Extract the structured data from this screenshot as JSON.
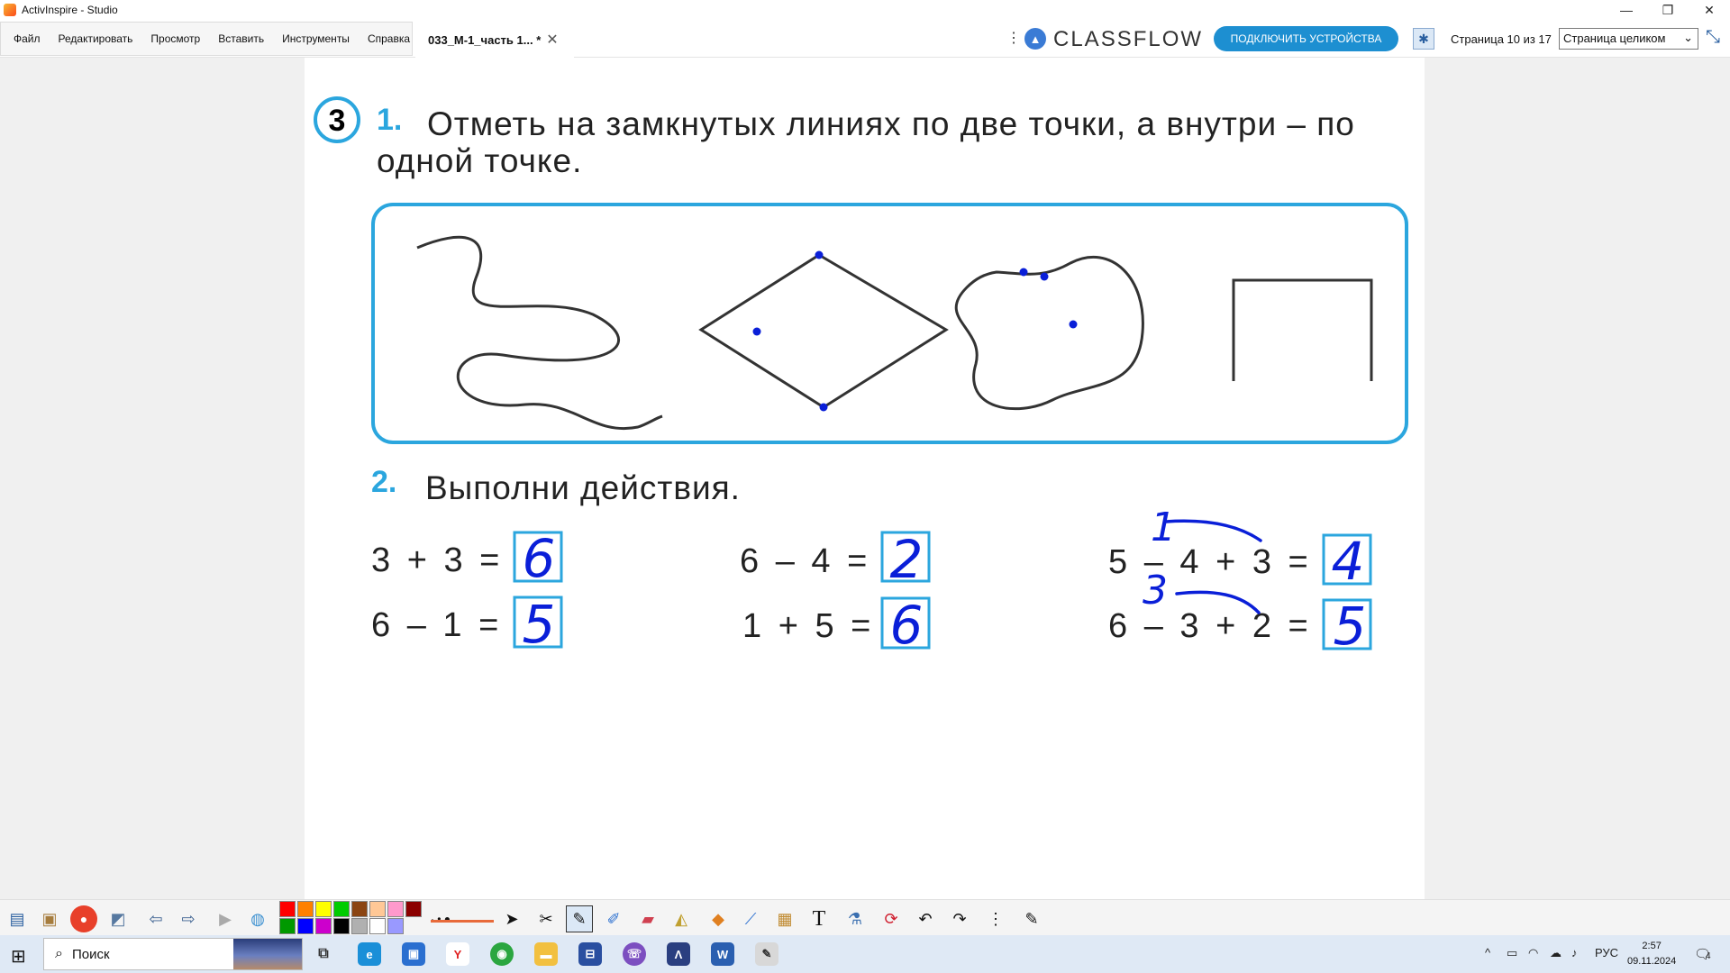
{
  "window": {
    "title": "ActivInspire - Studio",
    "minimize": "—",
    "restore": "❐",
    "close": "✕"
  },
  "menu": [
    "Файл",
    "Редактировать",
    "Просмотр",
    "Вставить",
    "Инструменты",
    "Справка"
  ],
  "tab": {
    "label": "033_М-1_часть 1... *",
    "close": "✕"
  },
  "classflow": {
    "logo": "CLASSFLOW",
    "connect_label": "ПОДКЛЮЧИТЬ УСТРОЙСТВА"
  },
  "page": {
    "counter": "Страница 10 из 17",
    "zoom": "Страница целиком"
  },
  "worksheet": {
    "lesson_number": "3",
    "task1_number": "1.",
    "task1_line1": "Отметь на замкнутых линиях по две точки, а внутри – по",
    "task1_line2": "одной точке.",
    "task2_number": "2.",
    "task2_text": "Выполни действия.",
    "expressions": [
      {
        "expr": "3 + 3 =",
        "answer": "6"
      },
      {
        "expr": "6 – 1 =",
        "answer": "5"
      },
      {
        "expr": "6 – 4 =",
        "answer": "2"
      },
      {
        "expr": "1 + 5 =",
        "answer": "6"
      },
      {
        "expr": "5 – 4 + 3 =",
        "answer": "4",
        "note": "1"
      },
      {
        "expr": "6 – 3 + 2 =",
        "answer": "5",
        "note": "3"
      }
    ],
    "ink_color": "#0a1fd8",
    "accent_color": "#2ba6de"
  },
  "toolbar": {
    "palette": [
      "#ff0000",
      "#ff8000",
      "#ffff00",
      "#00cc00",
      "#8b4513",
      "#ffc896",
      "#ff99cc",
      "#8b0000",
      "#009900",
      "#0000ff",
      "#cc00cc",
      "#000000",
      "#b0b0b0",
      "#ffffff",
      "#9999ff"
    ]
  },
  "taskbar": {
    "search_placeholder": "Поиск",
    "lang": "РУС",
    "time": "2:57",
    "date": "09.11.2024",
    "notifications": "4"
  }
}
